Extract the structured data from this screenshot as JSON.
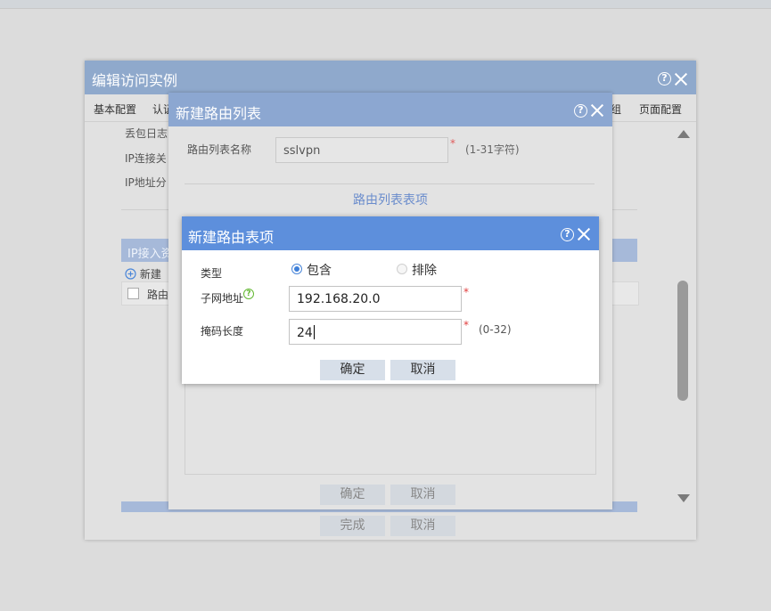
{
  "outer_dialog": {
    "title": "编辑访问实例",
    "tabs": [
      "基本配置",
      "认证",
      "组",
      "页面配置"
    ],
    "side_labels": [
      "丢包日志",
      "IP连接关",
      "IP地址分"
    ],
    "section_title": "IP接入资",
    "add_label": "新建",
    "table_header": "路由",
    "buttons": {
      "finish": "完成",
      "cancel": "取消"
    }
  },
  "middle_dialog": {
    "title": "新建路由列表",
    "name_label": "路由列表名称",
    "name_value": "sslvpn",
    "name_hint": "(1-31字符)",
    "section_title": "路由列表表项",
    "buttons": {
      "ok": "确定",
      "cancel": "取消"
    }
  },
  "inner_dialog": {
    "title": "新建路由表项",
    "type_label": "类型",
    "type_options": [
      {
        "label": "包含",
        "selected": true
      },
      {
        "label": "排除",
        "selected": false
      }
    ],
    "subnet_label": "子网地址",
    "subnet_value": "192.168.20.0",
    "mask_label": "掩码长度",
    "mask_value": "24",
    "mask_hint": "(0-32)",
    "required_mark": "*",
    "buttons": {
      "ok": "确定",
      "cancel": "取消"
    }
  },
  "colors": {
    "outer_titlebar": "#8fa9cc",
    "middle_titlebar": "#8ca7d1",
    "inner_titlebar": "#5d8fdc",
    "required": "#e03c3c",
    "help_green": "#63b832"
  },
  "icons": [
    "help-icon",
    "close-icon",
    "plus-circle-icon",
    "scroll-up-arrow-icon",
    "scroll-down-arrow-icon"
  ]
}
